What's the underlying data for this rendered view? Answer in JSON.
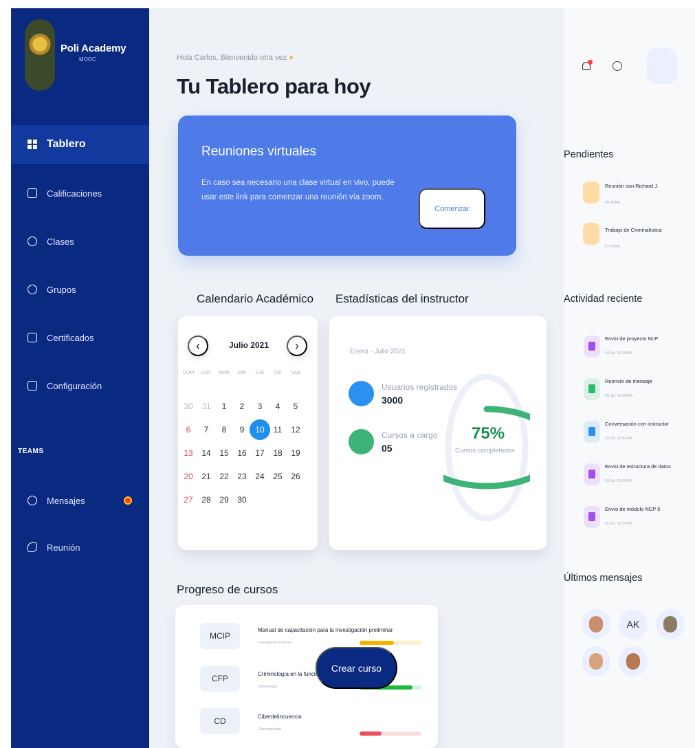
{
  "brand": {
    "name": "Poli Academy",
    "subtitle": "MOOC"
  },
  "sidebar": {
    "items": [
      {
        "label": "Tablero",
        "icon": "dashboard-icon"
      },
      {
        "label": "Calificaciones",
        "icon": "bar-chart-icon"
      },
      {
        "label": "Clases",
        "icon": "people-icon"
      },
      {
        "label": "Grupos",
        "icon": "group-icon"
      },
      {
        "label": "Certificados",
        "icon": "clipboard-icon"
      },
      {
        "label": "Configuración",
        "icon": "building-icon"
      }
    ],
    "teams_label": "TEAMS",
    "team_items": [
      {
        "label": "Mensajes",
        "icon": "chat-icon"
      },
      {
        "label": "Reunión",
        "icon": "phone-icon"
      }
    ]
  },
  "header": {
    "greeting": "Hola Carlos, Bienvenido otra vez",
    "title": "Tu Tablero para hoy"
  },
  "banner": {
    "title": "Reuniones virtuales",
    "text": "En caso sea necesario una clase virtual en vivo, puede usar este link para comenzar una reunión vía zoom.",
    "button": "Comenzar"
  },
  "calendar": {
    "section": "Calendario Académico",
    "month": "Julio 2021",
    "dow": [
      "DOM",
      "LUN",
      "MAR",
      "MIE",
      "JUE",
      "VIE",
      "SAB"
    ],
    "days": [
      [
        "30",
        "31",
        "1",
        "2",
        "3",
        "4",
        "5"
      ],
      [
        "6",
        "7",
        "8",
        "9",
        "10",
        "11",
        "12"
      ],
      [
        "13",
        "14",
        "15",
        "16",
        "17",
        "18",
        "19"
      ],
      [
        "20",
        "21",
        "22",
        "23",
        "24",
        "25",
        "26"
      ],
      [
        "27",
        "28",
        "29",
        "30",
        "",
        "",
        ""
      ]
    ],
    "selected_day": "10"
  },
  "stats": {
    "section": "Estadísticas del instructor",
    "period": "Enero - Julio 2021",
    "users_label": "Usuarios registrados",
    "users_value": "3000",
    "courses_label": "Cursos a cargo",
    "courses_value": "05",
    "percent": "75%",
    "percent_label": "Cursos completados",
    "colors": {
      "accent": "#2a91f0",
      "success": "#3db377"
    }
  },
  "progress": {
    "section": "Progreso de cursos",
    "courses": [
      {
        "code": "MCIP",
        "name": "Manual de capacitación para la investigación preliminar",
        "category": "Investigación Criminal",
        "progress": 0.55,
        "color": "#f4b400"
      },
      {
        "code": "CFP",
        "name": "Criminología en la función policial",
        "category": "Criminología",
        "progress": 0.85,
        "color": "#1fb83f"
      },
      {
        "code": "CD",
        "name": "Ciberdelincuencia",
        "category": "Ciberseguridad",
        "progress": 0.35,
        "color": "#e8505b"
      }
    ],
    "create_button": "Crear curso"
  },
  "right": {
    "pending_title": "Pendientes",
    "pending": [
      {
        "title": "Reunión con Richard J.",
        "sub": "09:30AM"
      },
      {
        "title": "Trabajo de Criminalística",
        "sub": "07:00AM"
      }
    ],
    "activity_title": "Actividad reciente",
    "activity": [
      {
        "title": "Envío de proyecto NLP",
        "sub": "04 Jul, 10:20AM",
        "icon": "clipboard-icon",
        "color": "#a44cf0"
      },
      {
        "title": "Reenvío de mensaje",
        "sub": "04 Jul, 10:00AM",
        "icon": "forward-icon",
        "color": "#2dbb6a"
      },
      {
        "title": "Conversación con instructor",
        "sub": "03 Jul, 11:02AM",
        "icon": "mic-icon",
        "color": "#2a91f0"
      },
      {
        "title": "Envío de estructura de datos",
        "sub": "03 Jul, 02:00PM",
        "icon": "clipboard-icon",
        "color": "#a44cf0"
      },
      {
        "title": "Envío de módulo NCP 5",
        "sub": "02 Jul, 12:20PM",
        "icon": "clipboard-icon",
        "color": "#a44cf0"
      }
    ],
    "messages_title": "Últimos mensajes",
    "initials": "AK"
  }
}
